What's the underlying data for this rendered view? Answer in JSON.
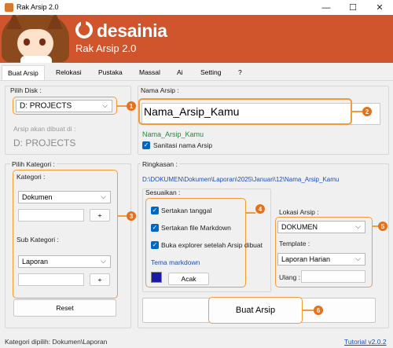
{
  "window": {
    "title": "Rak Arsip 2.0",
    "minimize": "—",
    "maximize": "☐",
    "close": "✕"
  },
  "header": {
    "brand": "desainia",
    "subtitle": "Rak Arsip 2.0",
    "bg": "#d0552c"
  },
  "tabs": [
    {
      "label": "Buat Arsip",
      "active": true
    },
    {
      "label": "Relokasi"
    },
    {
      "label": "Pustaka"
    },
    {
      "label": "Massal"
    },
    {
      "label": "Ai"
    },
    {
      "label": "Setting"
    },
    {
      "label": "?"
    }
  ],
  "disk": {
    "label": "Pilih Disk :",
    "value": "D: PROJECTS",
    "created_label": "Arsip akan dibuat di :",
    "created_value": "D:  PROJECTS"
  },
  "nama": {
    "label": "Nama Arsip :",
    "value": "Nama_Arsip_Kamu",
    "preview": "Nama_Arsip_Kamu",
    "sanitize_label": "Sanitasi nama Arsip"
  },
  "kategori": {
    "group_label": "Pilih Kategori :",
    "label": "Kategori :",
    "value": "Dokumen",
    "add": "+",
    "sub_label": "Sub Kategori :",
    "sub_value": "Laporan",
    "sub_add": "+",
    "reset": "Reset"
  },
  "ringkasan": {
    "label": "Ringkasan :",
    "path": "D:\\DOKUMEN\\Dokumen\\Laporan\\2025\\Januari\\12\\Nama_Arsip_Kamu"
  },
  "sesuaikan": {
    "label": "Sesuaikan :",
    "opt_tanggal": "Sertakan tanggal",
    "opt_markdown": "Sertakan file Markdown",
    "opt_explorer": "Buka explorer setelah Arsip dibuat",
    "tema": "Tema markdown",
    "tema_color": "#1a1aa6",
    "acak": "Acak"
  },
  "lokasi": {
    "label": "Lokasi Arsip :",
    "value": "DOKUMEN",
    "template_label": "Template :",
    "template_value": "Laporan Harian",
    "ulang_label": "Ulang :"
  },
  "actions": {
    "create": "Buat Arsip"
  },
  "badges": [
    "1",
    "2",
    "3",
    "4",
    "5",
    "6"
  ],
  "status": {
    "text": "Kategori dipilih: Dokumen\\Laporan",
    "tutorial": "Tutorial v2.0.2"
  },
  "colors": {
    "accent": "#f39a3b",
    "badge": "#e8701a",
    "link": "#1a4ec0",
    "preview_green": "#1d8a3a",
    "checkbox": "#0067c0"
  }
}
